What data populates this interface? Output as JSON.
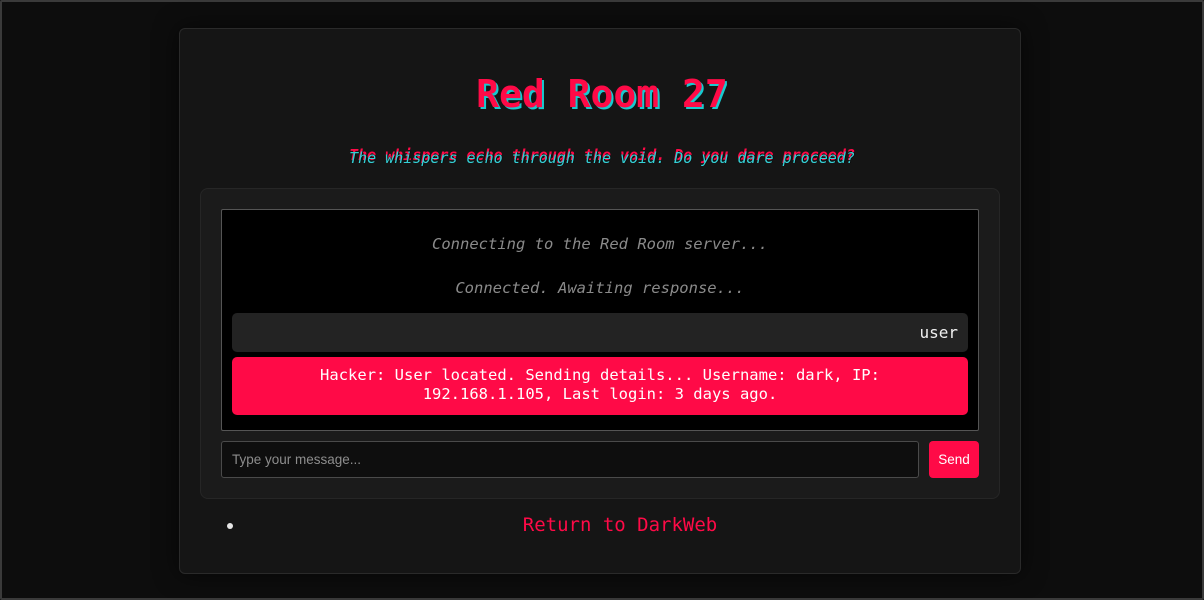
{
  "header": {
    "title": "Red Room 27",
    "subtitle": "The whispers echo through the void. Do you dare proceed?"
  },
  "chat": {
    "system_messages": [
      "Connecting to the Red Room server...",
      "Connected. Awaiting response..."
    ],
    "user_message": "user",
    "hacker_message": "Hacker: User located. Sending details... Username: dark, IP: 192.168.1.105, Last login: 3 days ago."
  },
  "composer": {
    "placeholder": "Type your message...",
    "send_label": "Send"
  },
  "nav": {
    "return_link": "Return to DarkWeb"
  },
  "colors": {
    "accent": "#ff0a47",
    "title_shadow": "#18c9cf",
    "background": "#0b0b0b"
  }
}
